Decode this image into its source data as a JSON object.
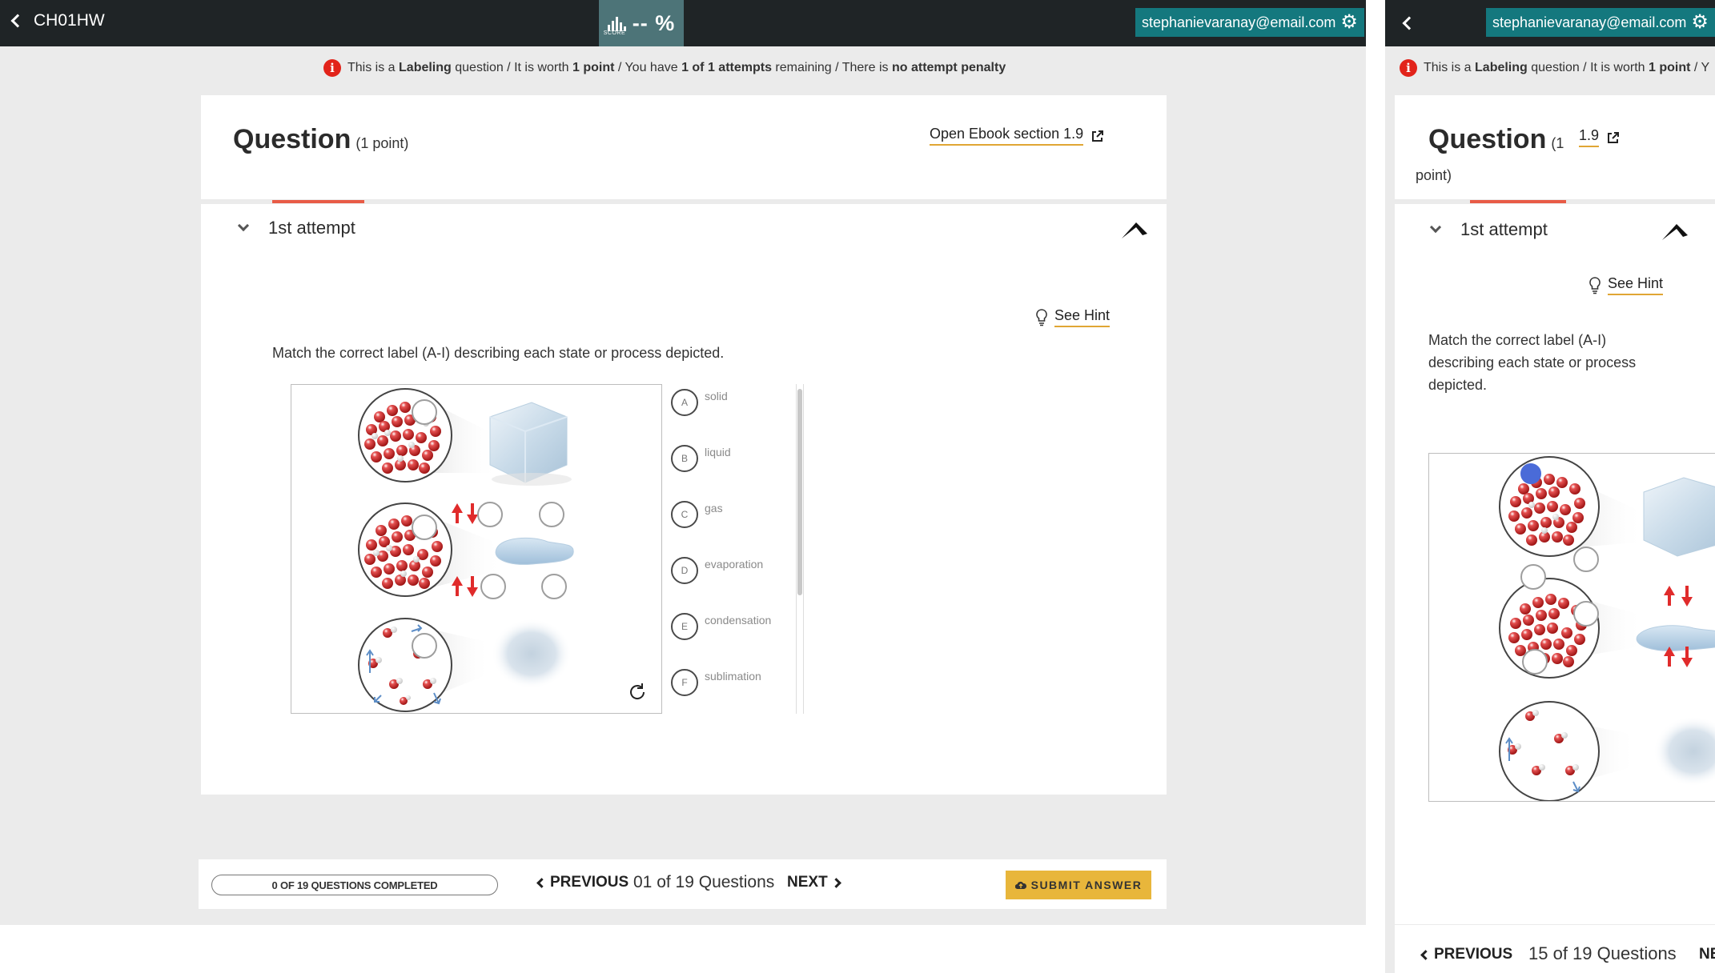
{
  "left": {
    "course_title": "CH01HW",
    "score": {
      "caption": "SCORE",
      "value": "-- %"
    },
    "user_email": "stephanievaranay@email.com",
    "info": {
      "p1": "This is a ",
      "b1": "Labeling",
      "p2": " question / It is worth ",
      "b2": "1 point",
      "p3": " / You have ",
      "b3": "1 of 1 attempts",
      "p4": " remaining / There is ",
      "b4": "no attempt penalty"
    },
    "question": {
      "title": "Question",
      "points": "(1 point)"
    },
    "ebook_link": "Open Ebook section 1.9",
    "attempt_label": "1st attempt",
    "hint_label": "See Hint",
    "instructions": "Match the correct label (A-I) describing each state or process depicted.",
    "labels": [
      {
        "letter": "A",
        "text": "solid"
      },
      {
        "letter": "B",
        "text": "liquid"
      },
      {
        "letter": "C",
        "text": "gas"
      },
      {
        "letter": "D",
        "text": "evaporation"
      },
      {
        "letter": "E",
        "text": "condensation"
      },
      {
        "letter": "F",
        "text": "sublimation"
      }
    ],
    "progress_text": "0 OF 19 QUESTIONS COMPLETED",
    "prev_label": "PREVIOUS",
    "counter": "01 of 19  Questions",
    "next_label": "NEXT",
    "submit_label": "SUBMIT ANSWER"
  },
  "right": {
    "user_email": "stephanievaranay@email.com",
    "info": {
      "p1": "This is a ",
      "b1": "Labeling",
      "p2": " question / It is worth ",
      "b2": "1 point",
      "p3": " / Y"
    },
    "question": {
      "title": "Question",
      "points_1": "(1",
      "points_2": "point)"
    },
    "ebook_link": "1.9",
    "attempt_label": "1st attempt",
    "hint_label": "See Hint",
    "instructions": "Match the correct label (A-I) describing each state or process depicted.",
    "prev_label": "PREVIOUS",
    "counter": "15 of 19 Questions",
    "next_label": "NE"
  },
  "colors": {
    "topbar": "#1f2426",
    "email_button": "#14787e",
    "score_box": "#4d7478",
    "tab_underline": "#e85b46",
    "link_underline": "#e0a634",
    "submit": "#e8b63b",
    "info_icon": "#e2231a",
    "selected_target": "#4a6bd8"
  },
  "icons": [
    "chevron-left-icon",
    "bar-chart-icon",
    "gear-icon",
    "info-icon",
    "external-link-icon",
    "chevron-down-icon",
    "pin-icon",
    "lightbulb-icon",
    "reset-icon",
    "arrow-up-icon",
    "arrow-down-icon",
    "upload-icon"
  ]
}
